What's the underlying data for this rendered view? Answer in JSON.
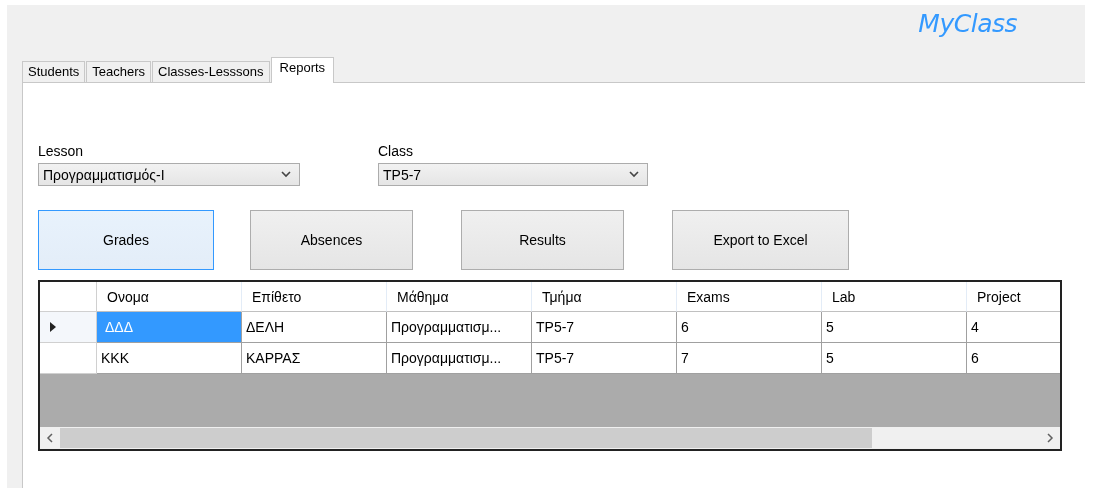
{
  "app_title": "MyClass",
  "tabs": [
    {
      "label": "Students",
      "selected": false
    },
    {
      "label": "Teachers",
      "selected": false
    },
    {
      "label": "Classes-Lesssons",
      "selected": false
    },
    {
      "label": "Reports",
      "selected": true
    }
  ],
  "filters": [
    {
      "label": "Lesson",
      "value": "Προγραμματισμός-Ι"
    },
    {
      "label": "Class",
      "value": "TP5-7"
    }
  ],
  "buttons": [
    {
      "label": "Grades",
      "focused": true
    },
    {
      "label": "Absences",
      "focused": false
    },
    {
      "label": "Results",
      "focused": false
    },
    {
      "label": "Export to Excel",
      "focused": false
    }
  ],
  "table": {
    "columns": [
      "Ονομα",
      "Επίθετο",
      "Μάθημα",
      "Τμήμα",
      "Exams",
      "Lab",
      "Project"
    ],
    "rows": [
      {
        "current": true,
        "selected": true,
        "cells": [
          "ΔΔΔ",
          "ΔΕΛΗ",
          "Προγραμματισμ...",
          "TP5-7",
          "6",
          "5",
          "4"
        ]
      },
      {
        "current": false,
        "selected": false,
        "cells": [
          "ΚΚΚ",
          "ΚΑΡΡΑΣ",
          "Προγραμματισμ...",
          "TP5-7",
          "7",
          "5",
          "6"
        ]
      }
    ]
  }
}
